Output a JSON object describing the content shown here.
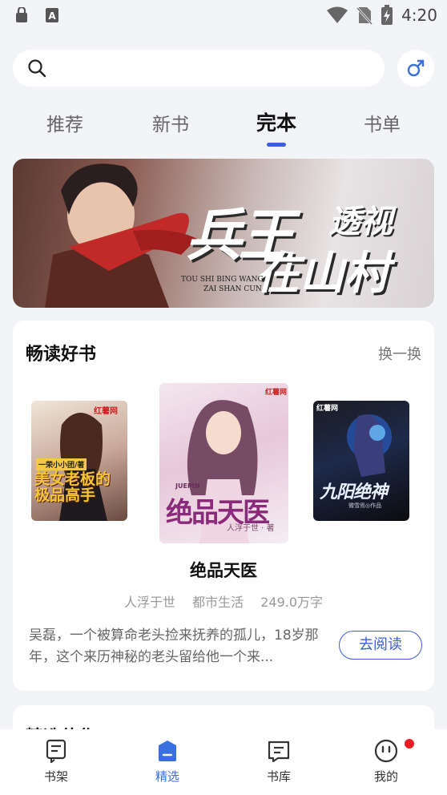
{
  "status_bar": {
    "time": "4:20",
    "icons": [
      "lock-app-icon",
      "font-app-icon",
      "wifi-icon",
      "no-sim-icon",
      "battery-charging-icon"
    ]
  },
  "header": {
    "search_icon": "search-icon",
    "gender_icon": "male-icon"
  },
  "tabs": [
    {
      "label": "推荐",
      "active": false
    },
    {
      "label": "新书",
      "active": false
    },
    {
      "label": "完本",
      "active": true
    },
    {
      "label": "书单",
      "active": false
    }
  ],
  "banner": {
    "title_main": "兵王",
    "title_sub": "透视",
    "title_second": "在山村",
    "pinyin_line1": "TOU SHI BING WANG",
    "pinyin_line2": "ZAI SHAN CUN"
  },
  "section": {
    "title": "畅读好书",
    "refresh_label": "换一换",
    "covers": [
      {
        "title": "美女老板的极品高手",
        "text_top": "一荣小小团/著",
        "publisher": "红薯网"
      },
      {
        "title": "绝品天医",
        "text_top": "JUEPIN",
        "author_line": "人浮于世 · 著",
        "publisher": "红薯网"
      },
      {
        "title": "九阳绝神",
        "text_top": "红薯网",
        "author_line": "微雪焉◎作品",
        "publisher": "红薯网"
      }
    ],
    "featured_book": {
      "name": "绝品天医",
      "author": "人浮于世",
      "genre": "都市生活",
      "word_count": "249.0万字",
      "description": "吴磊，一个被算命老头捡来抚养的孤儿，18岁那年，这个来历神秘的老头留给他一个来...",
      "read_button": "去阅读"
    }
  },
  "next_section": {
    "title": "精选佳作"
  },
  "bottom_nav": [
    {
      "label": "书架",
      "icon": "bookshelf-icon",
      "active": false
    },
    {
      "label": "精选",
      "icon": "featured-icon",
      "active": true
    },
    {
      "label": "书库",
      "icon": "library-icon",
      "active": false
    },
    {
      "label": "我的",
      "icon": "profile-icon",
      "active": false,
      "badge": true
    }
  ],
  "colors": {
    "accent": "#3a5fd6",
    "badge": "#ee1c25",
    "background": "#f3f4f8"
  }
}
